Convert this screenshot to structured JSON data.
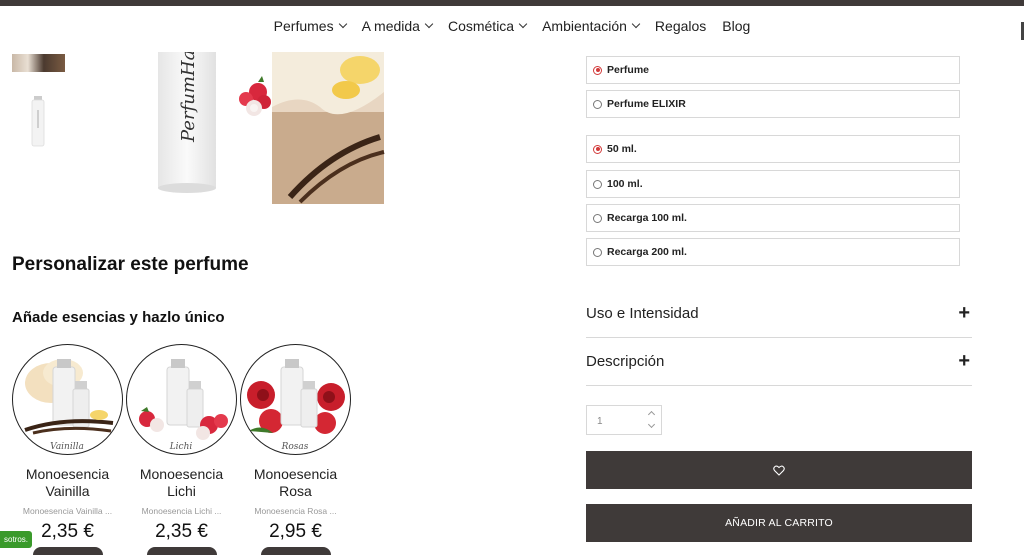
{
  "nav": {
    "items": [
      {
        "label": "Perfumes",
        "dropdown": true
      },
      {
        "label": "A medida",
        "dropdown": true
      },
      {
        "label": "Cosmética",
        "dropdown": true
      },
      {
        "label": "Ambientación",
        "dropdown": true
      },
      {
        "label": "Regalos",
        "dropdown": false
      },
      {
        "label": "Blog",
        "dropdown": false
      }
    ]
  },
  "product": {
    "bottle_text": "PerfumHad"
  },
  "personalize": {
    "title": "Personalizar este perfume",
    "subtitle": "Añade esencias y hazlo único"
  },
  "essences": [
    {
      "title_line1": "Monoesencia",
      "title_line2": "Vainilla",
      "subtitle": "Monoesencia Vainilla ...",
      "price": "2,35 €",
      "image_label": "Vainilla"
    },
    {
      "title_line1": "Monoesencia",
      "title_line2": "Lichi",
      "subtitle": "Monoesencia Lichi ...",
      "price": "2,35 €",
      "image_label": "Lichi"
    },
    {
      "title_line1": "Monoesencia",
      "title_line2": "Rosa",
      "subtitle": "Monoesencia Rosa ...",
      "price": "2,95 €",
      "image_label": "Rosas"
    }
  ],
  "badge": {
    "label": "sotros."
  },
  "type_options": [
    {
      "label": "Perfume",
      "selected": true
    },
    {
      "label": "Perfume ELIXIR",
      "selected": false
    }
  ],
  "size_options": [
    {
      "label": "50 ml.",
      "selected": true
    },
    {
      "label": "100 ml.",
      "selected": false
    },
    {
      "label": "Recarga 100 ml.",
      "selected": false
    },
    {
      "label": "Recarga 200 ml.",
      "selected": false
    }
  ],
  "accordions": [
    {
      "label": "Uso e Intensidad",
      "icon": "plus-icon"
    },
    {
      "label": "Descripción",
      "icon": "plus-icon"
    }
  ],
  "quantity": {
    "value": "1"
  },
  "buttons": {
    "wishlist_icon": "heart-icon",
    "add_to_cart": "AÑADIR AL CARRITO"
  },
  "colors": {
    "dark": "#3f3a39",
    "radio_selected": "#d23a3a",
    "badge": "#3a9a2b"
  }
}
